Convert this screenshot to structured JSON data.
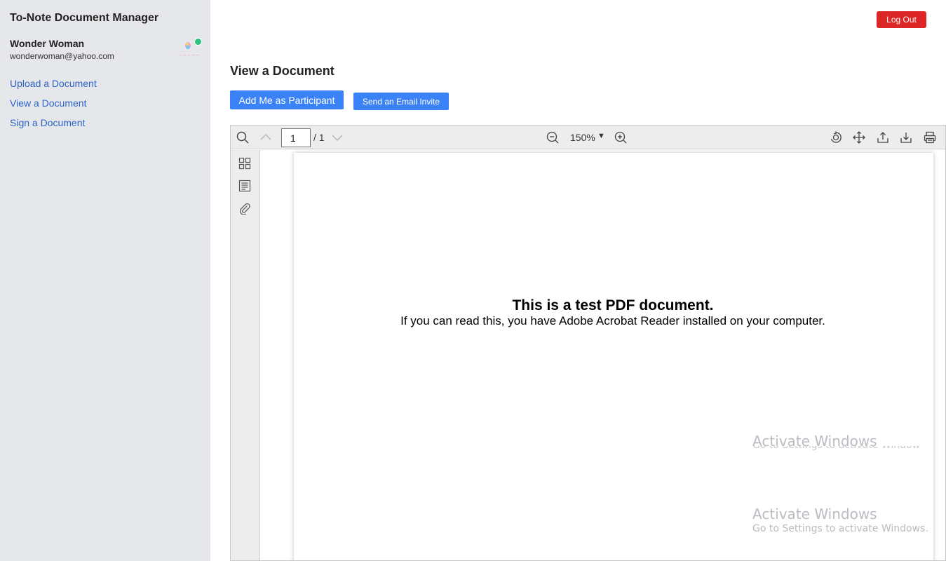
{
  "app": {
    "title": "To-Note Document Manager"
  },
  "user": {
    "name": "Wonder Woman",
    "email": "wonderwoman@yahoo.com"
  },
  "sidebar": {
    "items": [
      {
        "label": "Upload a Document"
      },
      {
        "label": "View a Document"
      },
      {
        "label": "Sign a Document"
      }
    ]
  },
  "header": {
    "logout_label": "Log Out"
  },
  "main": {
    "title": "View a Document",
    "add_participant_label": "Add Me as Participant",
    "email_invite_label": "Send an Email Invite"
  },
  "viewer": {
    "page_current": "1",
    "page_total": "/ 1",
    "zoom": "150%",
    "zoom_caret": "▼",
    "document": {
      "heading": "This is a test PDF document.",
      "body": "If you can read this, you have Adobe Acrobat Reader installed on your computer."
    }
  },
  "watermark": {
    "title": "Activate Windows",
    "subtitle": "Go to Settings to activate Windows."
  },
  "colors": {
    "sidebar_bg": "#e6e7ea",
    "link": "#2a63c7",
    "primary": "#3b82f6",
    "danger": "#dc2626",
    "status_online": "#2ec27e"
  }
}
